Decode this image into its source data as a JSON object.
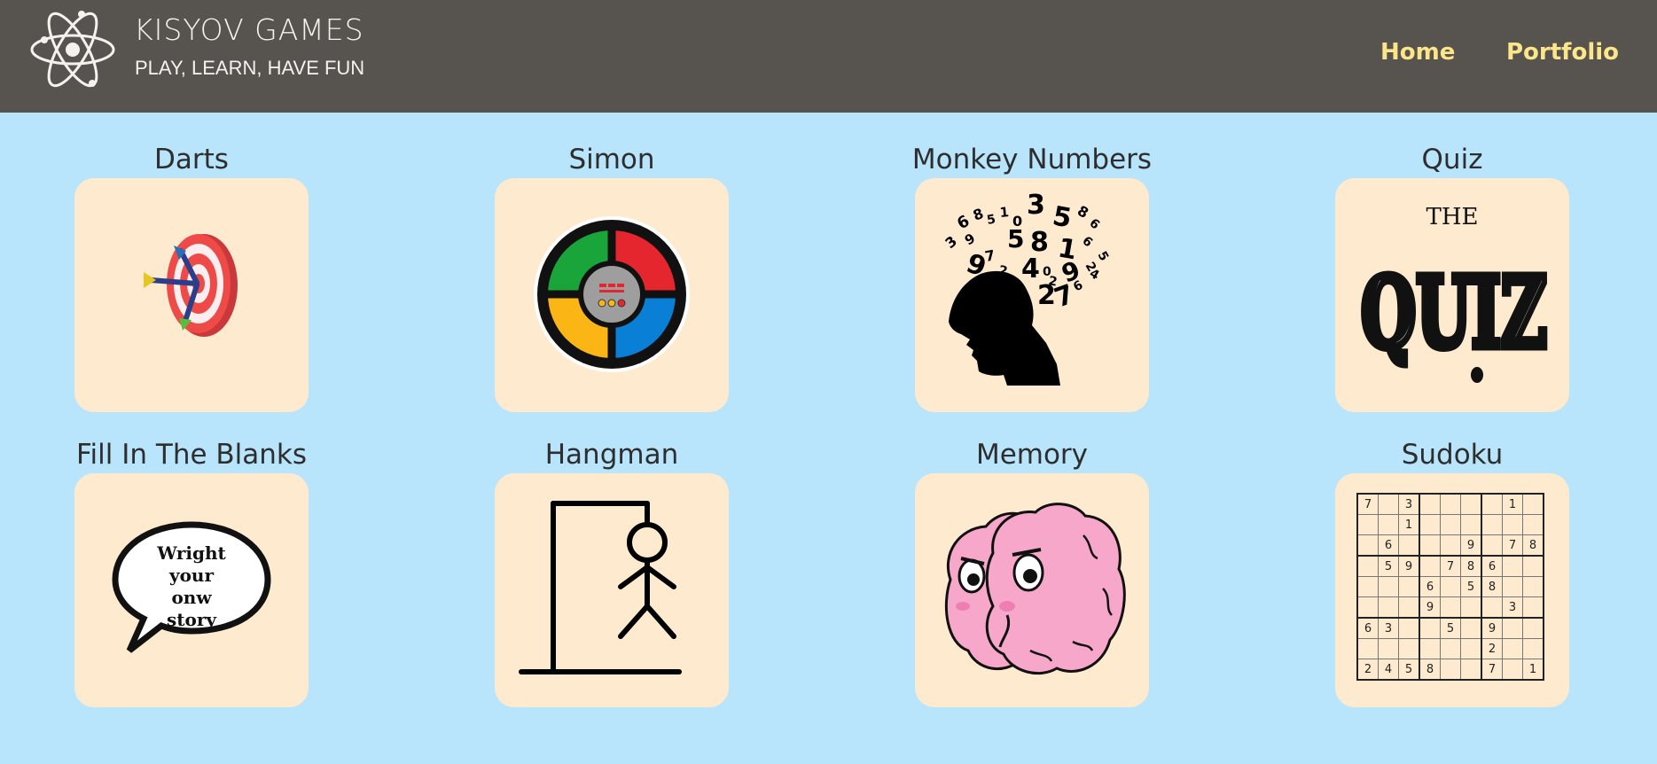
{
  "header": {
    "brand_title": "KISYOV GAMES",
    "brand_tagline": "PLAY, LEARN, HAVE FUN",
    "logo_icon": "atom-icon",
    "nav": [
      {
        "label": "Home"
      },
      {
        "label": "Portfolio"
      }
    ]
  },
  "games": [
    {
      "title": "Darts",
      "icon": "dartboard-icon"
    },
    {
      "title": "Simon",
      "icon": "simon-game-icon"
    },
    {
      "title": "Monkey Numbers",
      "icon": "head-numbers-icon"
    },
    {
      "title": "Quiz",
      "icon": "quiz-logo-icon",
      "image_text": [
        "THE",
        "QUIZ"
      ]
    },
    {
      "title": "Fill In The Blanks",
      "icon": "speech-bubble-icon",
      "image_text": [
        "Wright",
        "your",
        "onw",
        "story"
      ]
    },
    {
      "title": "Hangman",
      "icon": "gallows-icon"
    },
    {
      "title": "Memory",
      "icon": "brain-icon"
    },
    {
      "title": "Sudoku",
      "icon": "sudoku-grid-icon"
    }
  ],
  "sudoku_grid": [
    [
      "7",
      "",
      "3",
      "",
      "",
      "",
      "",
      "1",
      ""
    ],
    [
      "",
      "",
      "1",
      "",
      "",
      "",
      "",
      "",
      ""
    ],
    [
      "",
      "6",
      "",
      "",
      "",
      "9",
      "",
      "7",
      "8"
    ],
    [
      "",
      "5",
      "9",
      "",
      "7",
      "8",
      "6",
      "",
      ""
    ],
    [
      "",
      "",
      "",
      "6",
      "",
      "5",
      "8",
      "",
      ""
    ],
    [
      "",
      "",
      "",
      "9",
      "",
      "",
      "",
      "3",
      ""
    ],
    [
      "6",
      "3",
      "",
      "",
      "5",
      "",
      "9",
      "",
      ""
    ],
    [
      "",
      "",
      "",
      "",
      "",
      "",
      "2",
      "",
      ""
    ],
    [
      "2",
      "4",
      "5",
      "8",
      "",
      "",
      "7",
      "",
      "1"
    ]
  ],
  "monkey_digits": [
    "6",
    "8",
    "5",
    "1",
    "0",
    "3",
    "5",
    "8",
    "6",
    "3",
    "9",
    "5",
    "8",
    "1",
    "6",
    "2",
    "5",
    "7",
    "9",
    "2",
    "4",
    "0",
    "9",
    "4",
    "2",
    "7",
    "2",
    "6",
    "9"
  ],
  "colors": {
    "header_bg": "#57534e",
    "page_bg": "#b8e5fb",
    "card_bg": "#feebcf",
    "nav_text": "#fde58a",
    "simon_green": "#1aa53a",
    "simon_red": "#e5262f",
    "simon_yellow": "#fbb514",
    "simon_blue": "#0a7fd6"
  }
}
